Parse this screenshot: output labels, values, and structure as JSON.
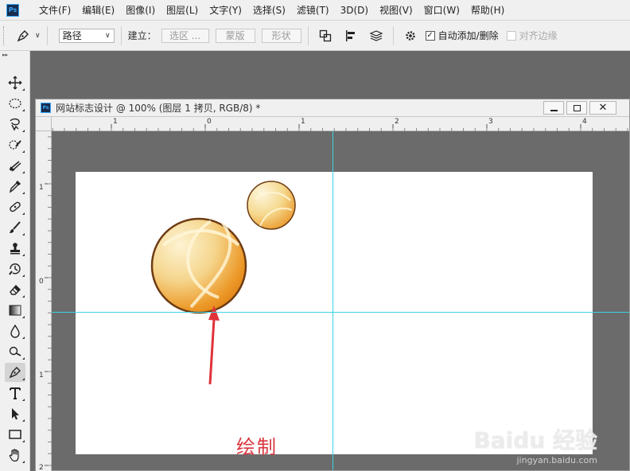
{
  "app": {
    "logo_text": "Ps"
  },
  "menu": [
    "文件(F)",
    "编辑(E)",
    "图像(I)",
    "图层(L)",
    "文字(Y)",
    "选择(S)",
    "滤镜(T)",
    "3D(D)",
    "视图(V)",
    "窗口(W)",
    "帮助(H)"
  ],
  "options": {
    "mode_value": "路径",
    "build_label": "建立：",
    "selection_btn": "选区 ...",
    "mask_btn": "蒙版",
    "shape_btn": "形状",
    "auto_add_delete": "自动添加/删除",
    "auto_add_delete_checked": true,
    "align_edges": "对齐边缘",
    "align_edges_checked": false
  },
  "tools": [
    "move-icon",
    "marquee-icon",
    "lasso-icon",
    "quick-select-icon",
    "crop-icon",
    "eyedropper-icon",
    "healing-icon",
    "brush-icon",
    "stamp-icon",
    "history-brush-icon",
    "eraser-icon",
    "gradient-icon",
    "blur-icon",
    "dodge-icon",
    "pen-icon",
    "type-icon",
    "path-select-icon",
    "rectangle-icon",
    "hand-icon"
  ],
  "active_tool": "pen-icon",
  "document": {
    "logo_text": "Ps",
    "title": "网站标志设计 @ 100% (图层 1 拷贝, RGB/8) *",
    "ruler_h_labels": [
      "1",
      "0",
      "1",
      "2",
      "3",
      "4"
    ],
    "ruler_v_labels": [
      "1",
      "0",
      "1",
      "2"
    ]
  },
  "annotation": {
    "text": "绘制",
    "color": "#d9363e"
  },
  "watermark": {
    "brand": "Baidu 经验",
    "url": "jingyan.baidu.com"
  },
  "colors": {
    "guide": "#39d3e4",
    "accent_orange": "#e8901a",
    "arrow": "#e0323a"
  }
}
